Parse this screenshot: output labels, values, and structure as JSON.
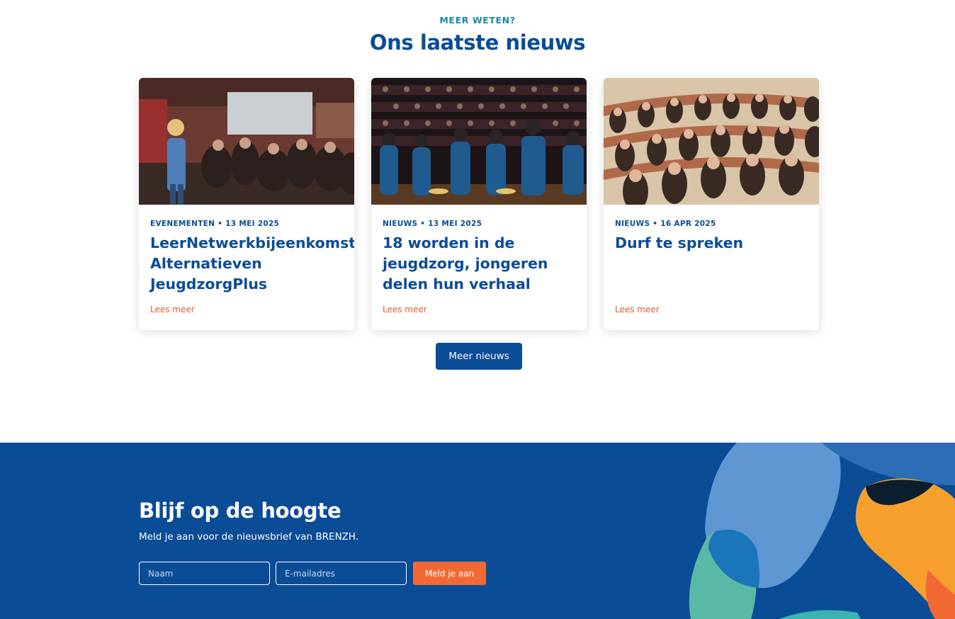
{
  "news": {
    "eyebrow": "MEER WETEN?",
    "title": "Ons laatste nieuws",
    "cards": [
      {
        "image": "speaker-with-audience-photo",
        "meta": "EVENEMENTEN • 13 MEI 2025",
        "title": "LeerNetwerkbijeenkomst Alternatieven JeugdzorgPlus",
        "link": "Lees meer"
      },
      {
        "image": "youth-on-stage-photo",
        "meta": "NIEUWS • 13 MEI 2025",
        "title": "18 worden in de jeugdzorg, jongeren delen hun verhaal",
        "link": "Lees meer"
      },
      {
        "image": "applauding-audience-photo",
        "meta": "NIEUWS • 16 APR 2025",
        "title": "Durf te spreken",
        "link": "Lees meer"
      }
    ],
    "more_button": "Meer nieuws"
  },
  "newsletter": {
    "title": "Blijf op de hoogte",
    "subtitle": "Meld je aan voor de nieuwsbrief van BRENZH.",
    "name_placeholder": "Naam",
    "email_placeholder": "E-mailadres",
    "submit_label": "Meld je aan"
  },
  "colors": {
    "brand_blue": "#0b4c97",
    "accent_orange": "#f26a33",
    "eyebrow_teal": "#1a8aa4"
  }
}
